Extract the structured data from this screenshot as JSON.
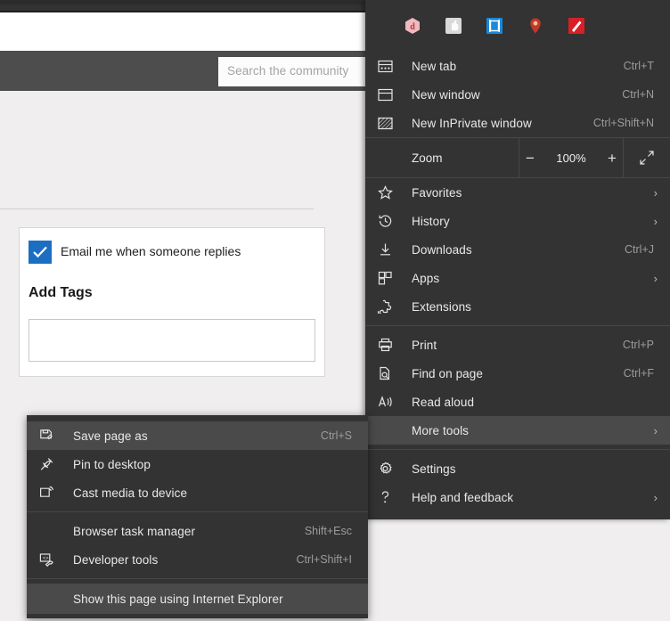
{
  "page": {
    "search": {
      "placeholder": "Search the community"
    },
    "card": {
      "checkbox_label": "Email me when someone replies",
      "checkbox_checked": true,
      "section_title": "Add Tags",
      "tag_input_value": ""
    },
    "colors": {
      "accent": "#1b6ec2",
      "navbar": "#4d4d4d",
      "background": "#f0eeee"
    }
  },
  "edge_menu": {
    "toolbar_icons": [
      {
        "name": "dictionary-extension-icon",
        "color": "#f2b8bd",
        "glyph": "d"
      },
      {
        "name": "gesture-extension-icon",
        "color": "#d8d8d8",
        "glyph": ""
      },
      {
        "name": "screenshot-extension-icon",
        "color": "#1c8adb",
        "glyph": ""
      },
      {
        "name": "location-pin-extension-icon",
        "color": "#c0392b",
        "glyph": ""
      },
      {
        "name": "highlighter-extension-icon",
        "color": "#d81f26",
        "glyph": ""
      }
    ],
    "items": [
      {
        "name": "new-tab",
        "icon": "new-tab-icon",
        "label": "New tab",
        "accel": "Ctrl+T",
        "chevron": false
      },
      {
        "name": "new-window",
        "icon": "new-window-icon",
        "label": "New window",
        "accel": "Ctrl+N",
        "chevron": false
      },
      {
        "name": "new-inprivate-window",
        "icon": "inprivate-icon",
        "label": "New InPrivate window",
        "accel": "Ctrl+Shift+N",
        "chevron": false
      },
      {
        "name": "favorites",
        "icon": "star-icon",
        "label": "Favorites",
        "accel": "",
        "chevron": true
      },
      {
        "name": "history",
        "icon": "history-clock-icon",
        "label": "History",
        "accel": "",
        "chevron": true
      },
      {
        "name": "downloads",
        "icon": "download-arrow-icon",
        "label": "Downloads",
        "accel": "Ctrl+J",
        "chevron": false
      },
      {
        "name": "apps",
        "icon": "apps-grid-icon",
        "label": "Apps",
        "accel": "",
        "chevron": true
      },
      {
        "name": "extensions",
        "icon": "puzzle-piece-icon",
        "label": "Extensions",
        "accel": "",
        "chevron": false
      },
      {
        "name": "print",
        "icon": "printer-icon",
        "label": "Print",
        "accel": "Ctrl+P",
        "chevron": false
      },
      {
        "name": "find-on-page",
        "icon": "find-page-icon",
        "label": "Find on page",
        "accel": "Ctrl+F",
        "chevron": false
      },
      {
        "name": "read-aloud",
        "icon": "read-aloud-icon",
        "label": "Read aloud",
        "accel": "",
        "chevron": false
      },
      {
        "name": "more-tools",
        "icon": "",
        "label": "More tools",
        "accel": "",
        "chevron": true
      },
      {
        "name": "settings",
        "icon": "gear-icon",
        "label": "Settings",
        "accel": "",
        "chevron": false
      },
      {
        "name": "help-and-feedback",
        "icon": "question-mark-icon",
        "label": "Help and feedback",
        "accel": "",
        "chevron": true
      }
    ],
    "zoom": {
      "label": "Zoom",
      "value": "100%",
      "minus": "−",
      "plus": "+",
      "fullscreen_icon": "fullscreen-arrows-icon"
    },
    "highlighted_item": "More tools"
  },
  "submenu": {
    "items": [
      {
        "name": "save-page-as",
        "icon": "save-disk-pencil-icon",
        "label": "Save page as",
        "accel": "Ctrl+S",
        "highlighted": true
      },
      {
        "name": "pin-to-desktop",
        "icon": "pin-icon",
        "label": "Pin to desktop",
        "accel": "",
        "highlighted": false
      },
      {
        "name": "cast-media-to-device",
        "icon": "cast-icon",
        "label": "Cast media to device",
        "accel": "",
        "highlighted": false
      },
      {
        "name": "browser-task-manager",
        "icon": "",
        "label": "Browser task manager",
        "accel": "Shift+Esc",
        "highlighted": false
      },
      {
        "name": "developer-tools",
        "icon": "devtools-icon",
        "label": "Developer tools",
        "accel": "Ctrl+Shift+I",
        "highlighted": false
      },
      {
        "name": "show-in-ie",
        "icon": "",
        "label": "Show this page using Internet Explorer",
        "accel": "",
        "highlighted": true
      }
    ]
  }
}
